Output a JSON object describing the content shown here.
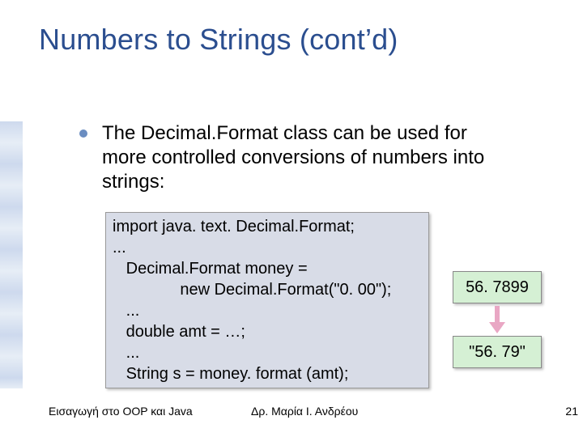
{
  "title": "Numbers to Strings (cont’d)",
  "bullet": "The Decimal.Format class can be used for more controlled conversions of numbers into strings:",
  "code": {
    "l1": "import java. text. Decimal.Format;",
    "l2": "...",
    "l3": "   Decimal.Format money =",
    "l4": "               new Decimal.Format(\"0. 00\");",
    "l5": "   ...",
    "l6": "   double amt = …;",
    "l7": "   ...",
    "l8": "   String s = money. format (amt);"
  },
  "value_before": "56. 7899",
  "value_after": "\"56. 79\"",
  "footer": {
    "left": "Εισαγωγή στο OOP και Java",
    "mid": "Δρ. Μαρία Ι. Ανδρέου",
    "right": "21"
  }
}
